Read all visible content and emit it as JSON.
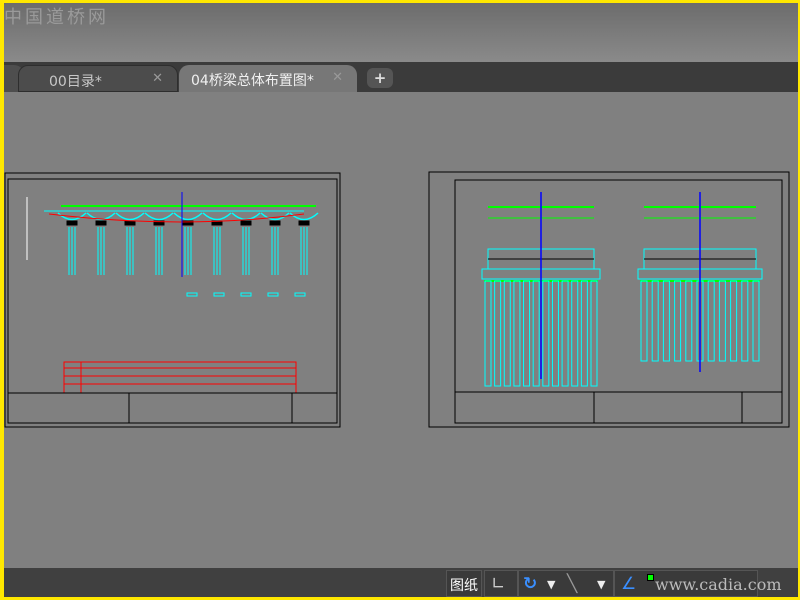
{
  "watermark": "中国道桥网",
  "tabs": [
    {
      "label": "00目录*",
      "active": false
    },
    {
      "label": "04桥梁总体布置图*",
      "active": true
    }
  ],
  "new_tab_label": "+",
  "close_glyph": "✕",
  "status": {
    "paper_label": "图纸",
    "overlay_watermark": "www.cadia.com"
  },
  "colors": {
    "canvas": "#808080",
    "accent_green": "#00ff00",
    "accent_cyan": "#00ffff",
    "accent_red": "#ff0000",
    "accent_blue": "#0000ff"
  }
}
